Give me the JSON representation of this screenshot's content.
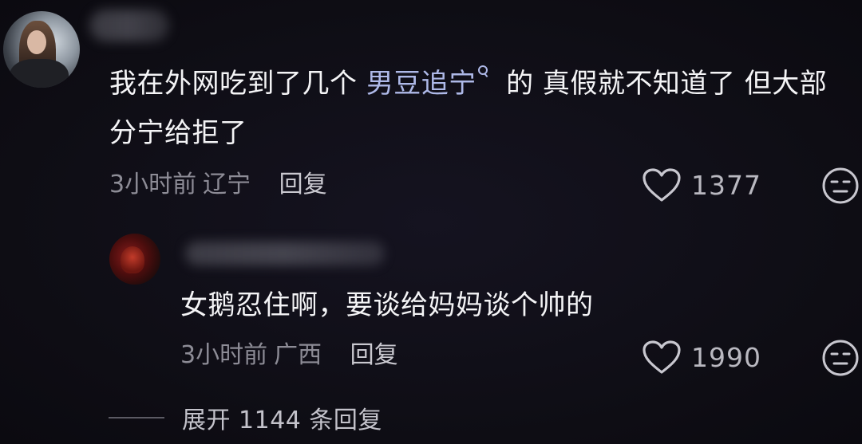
{
  "comment": {
    "text_before_link": "我在外网吃到了几个 ",
    "search_link": "男豆追宁",
    "text_after_link": " 的 真假就不知道了 但大部分宁给拒了",
    "time": "3小时前",
    "location": "辽宁",
    "reply_label": "回复",
    "like_count": "1377",
    "icons": {
      "search": "search-icon",
      "like": "heart-icon",
      "dislike": "dislike-face-icon"
    }
  },
  "reply": {
    "text": "女鹅忍住啊，要谈给妈妈谈个帅的",
    "time": "3小时前",
    "location": "广西",
    "reply_label": "回复",
    "like_count": "1990"
  },
  "expand": {
    "label": "展开 1144 条回复"
  },
  "colors": {
    "background": "#0f0e16",
    "text": "#f4f4f6",
    "meta": "#8d8c96",
    "link": "#aeb9e8"
  }
}
